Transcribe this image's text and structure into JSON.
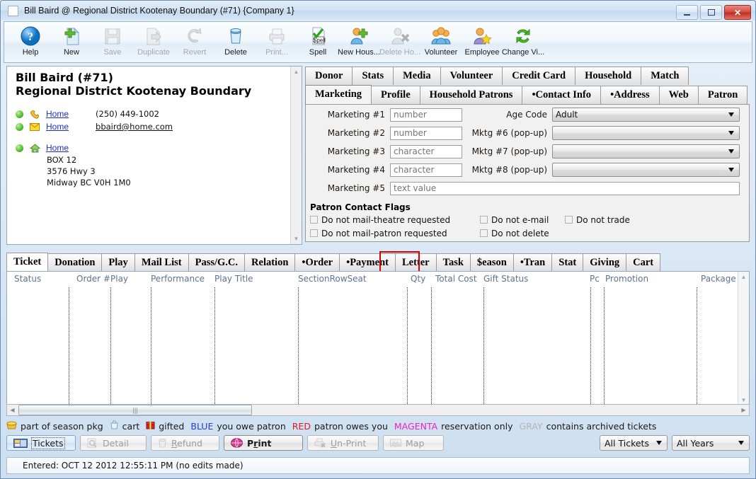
{
  "window": {
    "title": "Bill Baird @ Regional District Kootenay Boundary (#71) {Company 1}",
    "minimize_label": "Minimize",
    "maximize_label": "Maximize",
    "close_label": "✕"
  },
  "toolbar": [
    {
      "label": "Help",
      "icon": "help-icon",
      "disabled": false
    },
    {
      "label": "New",
      "icon": "new-document-icon",
      "disabled": false
    },
    {
      "label": "Save",
      "icon": "save-floppy-icon",
      "disabled": true
    },
    {
      "label": "Duplicate",
      "icon": "duplicate-icon",
      "disabled": true
    },
    {
      "label": "Revert",
      "icon": "revert-arrows-icon",
      "disabled": true
    },
    {
      "label": "Delete",
      "icon": "trash-can-icon",
      "disabled": false
    },
    {
      "label": "Print...",
      "icon": "printer-icon",
      "disabled": true
    },
    {
      "label": "Spell",
      "icon": "spell-check-icon",
      "disabled": false
    },
    {
      "label": "New Hous...",
      "icon": "new-household-icon",
      "disabled": false
    },
    {
      "label": "Delete Ho...",
      "icon": "delete-household-icon",
      "disabled": true
    },
    {
      "label": "Volunteer",
      "icon": "volunteer-group-icon",
      "disabled": false
    },
    {
      "label": "Employee",
      "icon": "employee-star-icon",
      "disabled": false
    },
    {
      "label": "Change Vi...",
      "icon": "change-view-refresh-icon",
      "disabled": false
    }
  ],
  "patron": {
    "name_line1": "Bill Baird (#71)",
    "name_line2": "Regional District Kootenay Boundary",
    "contacts": [
      {
        "type_icon": "phone-icon",
        "label": "Home",
        "value": "(250) 449-1002",
        "value_is_link": false
      },
      {
        "type_icon": "email-icon",
        "label": "Home",
        "value": "bbaird@home.com",
        "value_is_link": true
      }
    ],
    "address": {
      "type_icon": "house-icon",
      "label": "Home",
      "lines": [
        "BOX 12",
        "3576 Hwy 3",
        "Midway BC  V0H 1M0"
      ]
    }
  },
  "top_tabs_row1": [
    "Donor",
    "Stats",
    "Media",
    "Volunteer",
    "Credit Card",
    "Household",
    "Match"
  ],
  "top_tabs_row2": [
    "Marketing",
    "Profile",
    "Household Patrons",
    "•Contact Info",
    "•Address",
    "Web",
    "Patron"
  ],
  "top_tabs_active": "Marketing",
  "marketing": {
    "fields": [
      {
        "label": "Marketing #1",
        "placeholder": "number",
        "value": ""
      },
      {
        "label": "Marketing #2",
        "placeholder": "number",
        "value": ""
      },
      {
        "label": "Marketing #3",
        "placeholder": "character",
        "value": ""
      },
      {
        "label": "Marketing #4",
        "placeholder": "character",
        "value": ""
      }
    ],
    "field5": {
      "label": "Marketing #5",
      "placeholder": "text value",
      "value": ""
    },
    "popups": [
      {
        "label": "Age Code",
        "value": "Adult"
      },
      {
        "label": "Mktg #6 (pop-up)",
        "value": ""
      },
      {
        "label": "Mktg #7 (pop-up)",
        "value": ""
      },
      {
        "label": "Mktg #8 (pop-up)",
        "value": ""
      }
    ]
  },
  "contact_flags": {
    "title": "Patron Contact Flags",
    "rows": [
      [
        "Do not mail-theatre requested",
        "Do not e-mail",
        "Do not trade"
      ],
      [
        "Do not mail-patron requested",
        "Do not delete",
        ""
      ]
    ]
  },
  "bottom_tabs": [
    "Ticket",
    "Donation",
    "Play",
    "Mail List",
    "Pass/G.C.",
    "Relation",
    "•Order",
    "•Payment",
    "Letter",
    "Task",
    "$eason",
    "•Tran",
    "Stat",
    "Giving",
    "Cart"
  ],
  "bottom_tabs_active": "Ticket",
  "bottom_tabs_highlighted": "Task",
  "grid": {
    "columns": [
      "Status",
      "Order #",
      "Play",
      "Performance",
      "Play Title",
      "SectionRowSeat",
      "Qty",
      "Total Cost",
      "Gift Status",
      "Pc",
      "Promotion",
      "Package"
    ],
    "rows": []
  },
  "legend": [
    {
      "icon": "season-package-icon",
      "text": "part of season pkg",
      "color": "#1a1a1a"
    },
    {
      "icon": "cart-icon",
      "text": "cart",
      "color": "#1a1a1a"
    },
    {
      "icon": "gift-icon",
      "text": "gifted",
      "color": "#1a1a1a"
    },
    {
      "key": "BLUE",
      "key_color": "#2b3fd8",
      "text": "you owe patron",
      "color": "#1a1a1a"
    },
    {
      "key": "RED",
      "key_color": "#e01b1b",
      "text": "patron owes you",
      "color": "#1a1a1a"
    },
    {
      "key": "MAGENTA",
      "key_color": "#f020c0",
      "text": "reservation only",
      "color": "#1a1a1a"
    },
    {
      "key": "GRAY",
      "key_color": "#b4b4b4",
      "text": "contains archived tickets",
      "color": "#1a1a1a"
    }
  ],
  "action_buttons": [
    {
      "label": "Tickets",
      "icon": "ticket-icon",
      "state": "focused"
    },
    {
      "label": "Detail",
      "icon": "magnifier-icon",
      "state": "disabled"
    },
    {
      "label": "Refund",
      "icon": "trash-icon",
      "state": "disabled",
      "mnemonic": "R"
    },
    {
      "label": "Print",
      "icon": "print-globe-icon",
      "state": "enabled",
      "mnemonic": "r"
    },
    {
      "label": "Un-Print",
      "icon": "unprint-icon",
      "state": "disabled",
      "mnemonic": "U"
    },
    {
      "label": "Map",
      "icon": "map-icon",
      "state": "disabled"
    }
  ],
  "filters": [
    {
      "name": "ticket-filter",
      "value": "All Tickets"
    },
    {
      "name": "year-filter",
      "value": "All Years"
    }
  ],
  "status": {
    "text": "Entered: OCT 12 2012 12:55:11 PM (no edits made)"
  }
}
